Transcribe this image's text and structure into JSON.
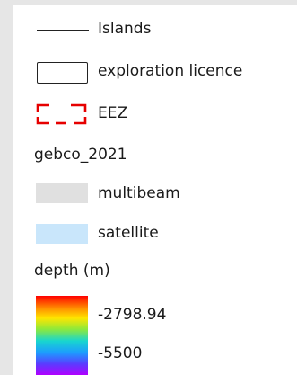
{
  "legend": {
    "items": [
      {
        "label": "Islands",
        "symbol": "line",
        "color": "#222222"
      },
      {
        "label": "exploration licence",
        "symbol": "outline-box",
        "color": "#222222"
      },
      {
        "label": "EEZ",
        "symbol": "dashed-red-box",
        "color": "#e60000"
      }
    ],
    "group_title": "gebco_2021",
    "group_items": [
      {
        "label": "multibeam",
        "color": "#e0e0e0"
      },
      {
        "label": "satellite",
        "color": "#c9e6fb"
      }
    ],
    "depth_title": "depth (m)",
    "depth_ramp": {
      "max_label": "-2798.94",
      "min_label": "-5500",
      "colors": [
        "#ff0000",
        "#ff8a00",
        "#ffe500",
        "#8fe93a",
        "#18d6cf",
        "#1d9bff",
        "#5a3cff",
        "#b000ff"
      ]
    }
  }
}
